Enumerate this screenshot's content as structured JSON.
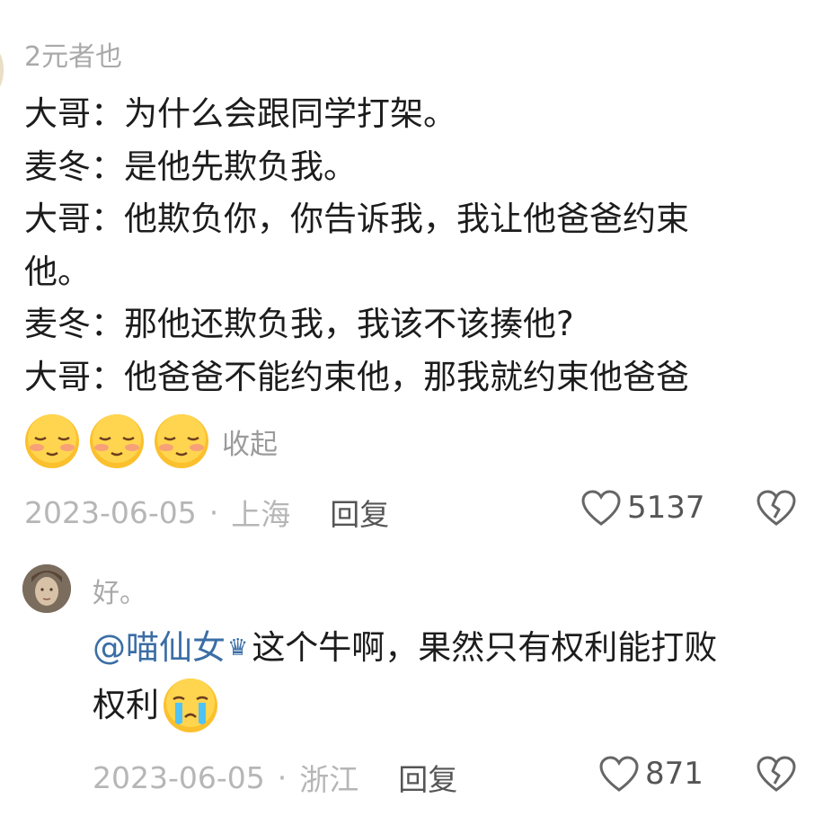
{
  "comment1": {
    "username": "2元者也",
    "lines": [
      "大哥：为什么会跟同学打架。",
      "麦冬：是他先欺负我。",
      "大哥：他欺负你，你告诉我，我让他爸爸约束",
      "他。",
      "麦冬：那他还欺负我，我该不该揍他?",
      "大哥：他爸爸不能约束他，那我就约束他爸爸"
    ],
    "emojis": [
      "shy-face",
      "shy-face",
      "shy-face"
    ],
    "collapse_label": "收起",
    "date": "2023-06-05",
    "separator": "·",
    "location": "上海",
    "reply_label": "回复",
    "likes": "5137"
  },
  "comment2": {
    "username": "好。",
    "mention": "@喵仙女",
    "crown_glyph": "♛",
    "line1_text": "这个牛啊，果然只有权利能打败",
    "line2_text": "权利",
    "emoji": "crying-face",
    "date": "2023-06-05",
    "separator": "·",
    "location": "浙江",
    "reply_label": "回复",
    "likes": "871"
  },
  "colors": {
    "mention": "#3b6ea5",
    "meta_gray": "#b6b6b6",
    "text": "#1c1c1c"
  }
}
